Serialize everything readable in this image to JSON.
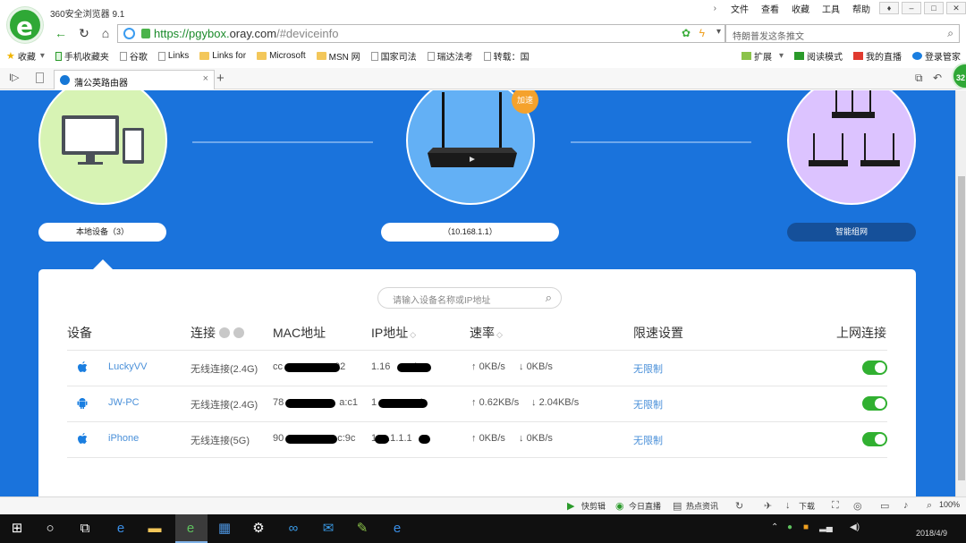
{
  "browser": {
    "title": "360安全浏览器 9.1",
    "menu": [
      "文件",
      "查看",
      "收藏",
      "工具",
      "帮助"
    ],
    "url": {
      "scheme": "https://",
      "sub": "pgybox.",
      "host": "oray.com",
      "frag": "/#deviceinfo"
    },
    "search_placeholder": "特朗普发这条推文",
    "bookmarks_left": [
      {
        "label": "收藏",
        "icon": "star-icon"
      },
      {
        "label": "手机收藏夹",
        "icon": "phone-icon"
      },
      {
        "label": "谷歌",
        "icon": "page-icon"
      },
      {
        "label": "Links",
        "icon": "page-icon"
      },
      {
        "label": "Links for",
        "icon": "folder-icon"
      },
      {
        "label": "Microsoft",
        "icon": "folder-icon"
      },
      {
        "label": "MSN 网",
        "icon": "folder-icon"
      },
      {
        "label": "国家司法",
        "icon": "page-icon"
      },
      {
        "label": "瑞达法考",
        "icon": "page-icon"
      },
      {
        "label": "转载：国",
        "icon": "page-icon"
      }
    ],
    "bookmarks_right": [
      "扩展",
      "阅读模式",
      "我的直播",
      "登录管家"
    ],
    "tab_title": "蒲公英路由器",
    "badge": "32"
  },
  "topology": {
    "local_label": "本地设备（3）",
    "router_label": "（10.168.1.1）",
    "mesh_label": "智能组网",
    "speed_badge": "加速"
  },
  "devices": {
    "search_placeholder": "请输入设备名称或IP地址",
    "headers": {
      "device": "设备",
      "connection": "连接",
      "mac": "MAC地址",
      "ip": "IP地址",
      "speed": "速率",
      "limit": "限速设置",
      "online": "上网连接"
    },
    "rows": [
      {
        "os": "apple-icon",
        "name": "LuckyVV",
        "conn": "无线连接(2.4G)",
        "mac_start": "cc",
        "mac_end": "92",
        "ip_start": "1",
        "ip_mid": ".16",
        "ip_end": ".1",
        "up": "0KB/s",
        "down": "0KB/s",
        "limit": "无限制"
      },
      {
        "os": "android-icon",
        "name": "JW-PC",
        "conn": "无线连接(2.4G)",
        "mac_start": "78",
        "mac_end": "a:c1",
        "ip_start": "1",
        "ip_mid": "",
        "ip_end": ".1",
        "up": "0.62KB/s",
        "down": "2.04KB/s",
        "limit": "无限制"
      },
      {
        "os": "apple-icon",
        "name": "iPhone",
        "conn": "无线连接(5G)",
        "mac_start": "90",
        "mac_end": "c:9c",
        "ip_start": "1",
        "ip_mid": ".1",
        "ip_end": ".1.1",
        "up": "0KB/s",
        "down": "0KB/s",
        "limit": "无限制"
      }
    ]
  },
  "statusbar": {
    "items": [
      "快剪辑",
      "今日直播",
      "热点资讯",
      "下载"
    ],
    "zoom": "100%"
  },
  "taskbar": {
    "date": "2018/4/9"
  }
}
